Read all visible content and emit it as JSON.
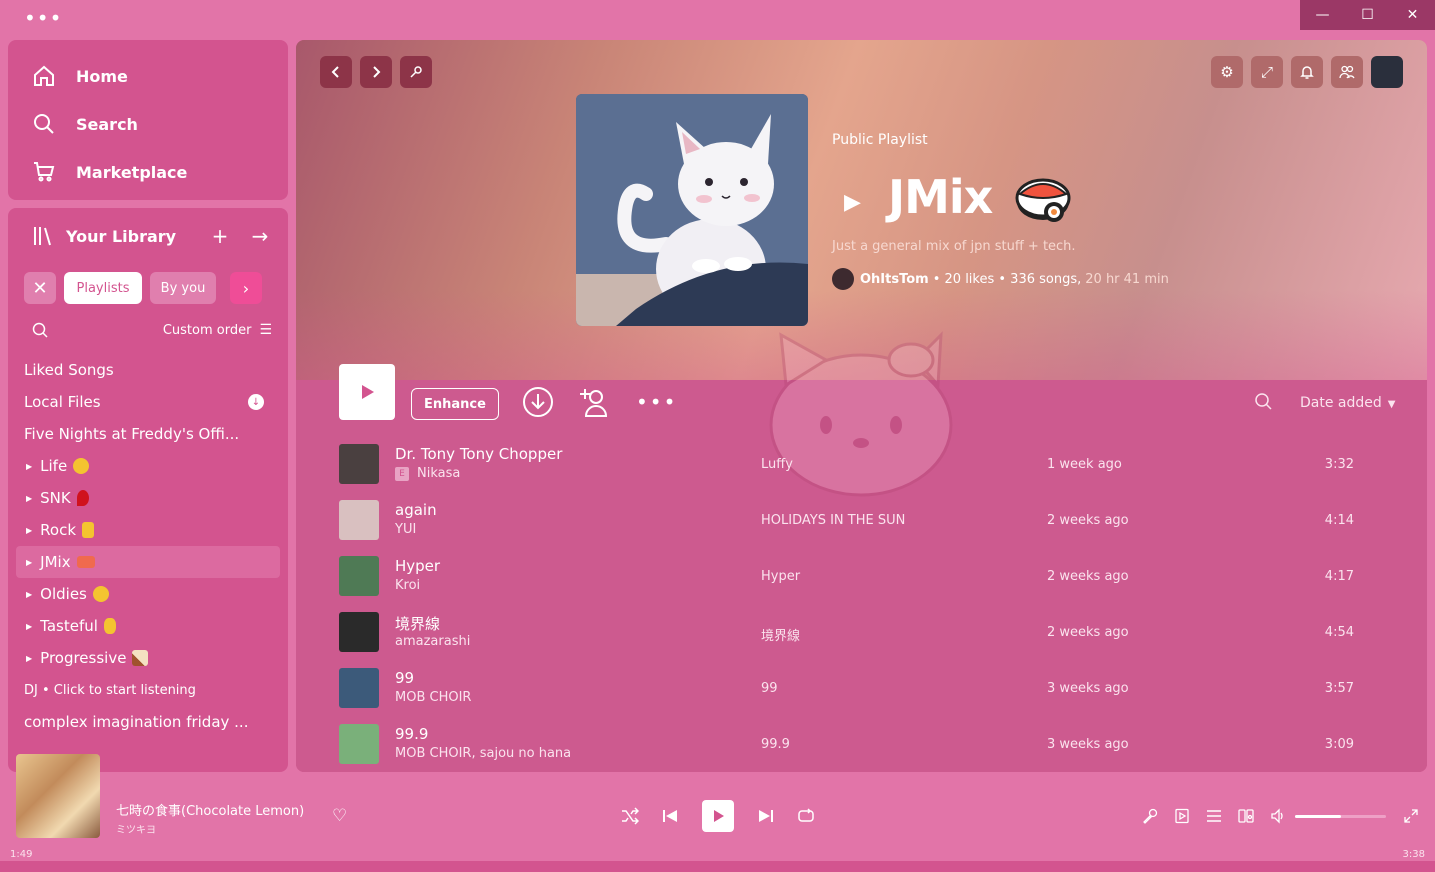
{
  "window": {
    "minimize": "—",
    "maximize": "☐",
    "close": "✕"
  },
  "nav": {
    "home": "Home",
    "search": "Search",
    "marketplace": "Marketplace"
  },
  "library": {
    "title": "Your Library",
    "chips": {
      "active": "Playlists",
      "second": "By you"
    },
    "sort_label": "Custom order",
    "items": [
      {
        "label": "Liked Songs"
      },
      {
        "label": "Local Files"
      },
      {
        "label": "Five Nights at Freddy's Offi..."
      },
      {
        "label": "Life",
        "emoji": "😟"
      },
      {
        "label": "SNK",
        "emoji": "🩸"
      },
      {
        "label": "Rock",
        "emoji": "🤘"
      },
      {
        "label": "JMix",
        "emoji": "🍣"
      },
      {
        "label": "Oldies",
        "emoji": "😬"
      },
      {
        "label": "Tasteful",
        "emoji": "👌"
      },
      {
        "label": "Progressive",
        "emoji": "🎸"
      },
      {
        "label": "DJ • Click to start listening"
      },
      {
        "label": "complex imagination friday ..."
      }
    ]
  },
  "playlist": {
    "type": "Public Playlist",
    "title": "JMix",
    "description": "Just a general mix of jpn stuff + tech.",
    "owner": "OhItsTom",
    "stats": "• 20 likes • 336 songs,",
    "duration": "20 hr 41 min"
  },
  "actions": {
    "enhance": "Enhance",
    "more": "•••",
    "sort": "Date added"
  },
  "tracks": [
    {
      "name": "Dr. Tony Tony Chopper",
      "artist": "Nikasa",
      "explicit": "E",
      "album": "Luffy",
      "added": "1 week ago",
      "duration": "3:32",
      "color": "#4a4040"
    },
    {
      "name": "again",
      "artist": "YUI",
      "album": "HOLIDAYS IN THE SUN",
      "added": "2 weeks ago",
      "duration": "4:14",
      "color": "#d9c0c0"
    },
    {
      "name": "Hyper",
      "artist": "Kroi",
      "album": "Hyper",
      "added": "2 weeks ago",
      "duration": "4:17",
      "color": "#4f7a55"
    },
    {
      "name": "境界線",
      "artist": "amazarashi",
      "album": "境界線",
      "added": "2 weeks ago",
      "duration": "4:54",
      "color": "#2a2a2a"
    },
    {
      "name": "99",
      "artist": "MOB CHOIR",
      "album": "99",
      "added": "3 weeks ago",
      "duration": "3:57",
      "color": "#3c5a7a"
    },
    {
      "name": "99.9",
      "artist": "MOB CHOIR, sajou no hana",
      "album": "99.9",
      "added": "3 weeks ago",
      "duration": "3:09",
      "color": "#7ab07a"
    }
  ],
  "now_playing": {
    "title": "七時の食事(Chocolate Lemon)",
    "artist": "ミツキヨ",
    "elapsed": "1:49",
    "total": "3:38",
    "volume": 0.5
  }
}
